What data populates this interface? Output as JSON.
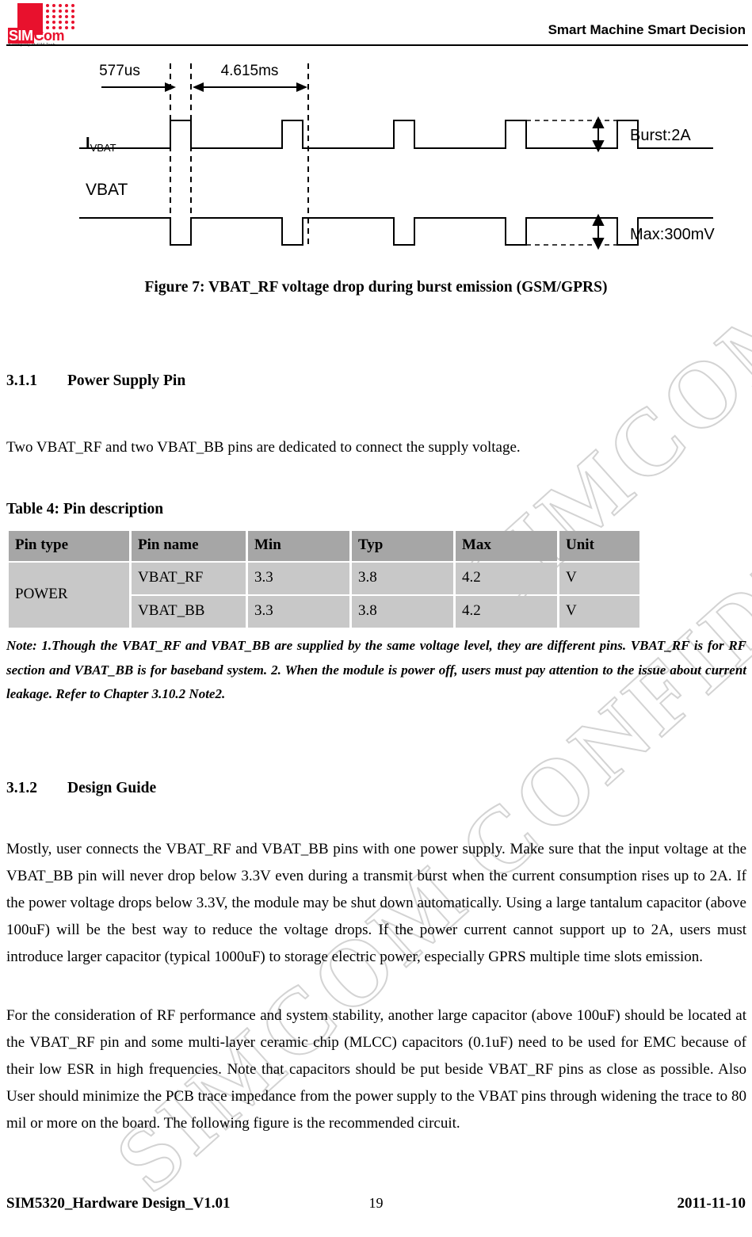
{
  "header": {
    "logo_name": "SIMCom",
    "logo_sim": "SIM",
    "logo_com": "Com",
    "logo_tagline": "A company of SIM Tech",
    "slogan": "Smart Machine Smart Decision"
  },
  "watermark": {
    "line1": "SIMCOM CONFIDENTIAL FILE",
    "line2": "SIMCOM CONFIDENTIAL FILE"
  },
  "figure": {
    "caption": "Figure 7: VBAT_RF voltage drop during burst emission (GSM/GPRS)",
    "dim_burst_width": "577us",
    "dim_frame_period": "4.615ms",
    "signal_current_label_main": "I",
    "signal_current_label_sub": "VBAT",
    "signal_voltage_label": "VBAT",
    "annot_current": "Burst:2A",
    "annot_voltage": "Max:300mV"
  },
  "sections": {
    "s311_num": "3.1.1",
    "s311_title": "Power Supply Pin",
    "s312_num": "3.1.2",
    "s312_title": "Design Guide"
  },
  "body": {
    "intro": "Two VBAT_RF and two VBAT_BB pins are dedicated to connect the supply voltage.",
    "design_p1": "Mostly, user connects the VBAT_RF and VBAT_BB pins with one power supply. Make sure that the input voltage at the VBAT_BB pin will never drop below 3.3V even during a transmit burst when the current consumption rises up to 2A. If the power voltage drops below 3.3V, the module may be shut down automatically. Using a large tantalum capacitor (above 100uF) will be the best way to reduce the voltage drops. If the power current cannot support up to 2A, users must introduce larger capacitor (typical 1000uF) to storage electric power, especially GPRS multiple time slots emission.",
    "design_p2": "For the consideration of RF performance and system stability, another large capacitor (above 100uF) should be located at the VBAT_RF pin and some multi-layer ceramic chip (MLCC) capacitors (0.1uF) need to be used for EMC because of their low ESR in high frequencies. Note that capacitors should be put beside VBAT_RF pins as close as possible. Also User should minimize the PCB trace impedance from the power supply to the VBAT pins through widening the trace to 80 mil or more on the board. The following figure is the recommended circuit.",
    "notes": "Note: 1.Though the VBAT_RF and VBAT_BB are supplied by the same voltage level, they are different pins. VBAT_RF is for RF section and VBAT_BB is for baseband system. 2. When the module is power off, users must pay attention to the issue about current leakage. Refer to Chapter 3.10.2 Note2."
  },
  "table": {
    "caption": "Table 4: Pin description",
    "headers": [
      "Pin type",
      "Pin name",
      "Min",
      "Typ",
      "Max",
      "Unit"
    ],
    "group_label": "POWER",
    "rows": [
      {
        "name": "VBAT_RF",
        "min": "3.3",
        "typ": "3.8",
        "max": "4.2",
        "unit": "V"
      },
      {
        "name": "VBAT_BB",
        "min": "3.3",
        "typ": "3.8",
        "max": "4.2",
        "unit": "V"
      }
    ]
  },
  "footer": {
    "document": "SIM5320_Hardware Design_V1.01",
    "page": "19",
    "date": "2011-11-10"
  },
  "colors": {
    "brand_red": "#e8112d",
    "table_header_bg": "#a6a6a6",
    "table_cell_bg": "#c8c8c8"
  }
}
